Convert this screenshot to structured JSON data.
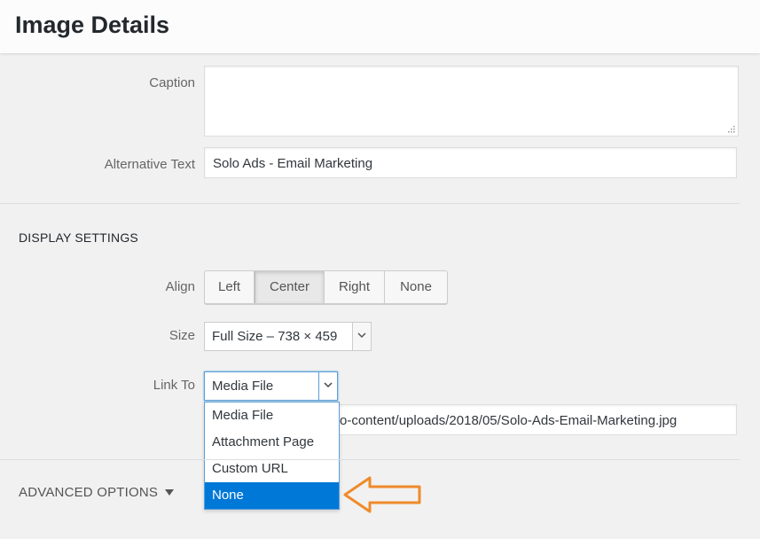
{
  "header": {
    "title": "Image Details"
  },
  "fields": {
    "caption_label": "Caption",
    "caption_value": "",
    "alt_label": "Alternative Text",
    "alt_value": "Solo Ads - Email Marketing",
    "url_value": "o-content/uploads/2018/05/Solo-Ads-Email-Marketing.jpg"
  },
  "display_settings": {
    "section_title": "DISPLAY SETTINGS",
    "align_label": "Align",
    "align_options": [
      "Left",
      "Center",
      "Right",
      "None"
    ],
    "align_selected": "Center",
    "size_label": "Size",
    "size_value": "Full Size – 738 × 459",
    "link_label": "Link To",
    "link_value": "Media File",
    "link_options": [
      "Media File",
      "Attachment Page",
      "Custom URL",
      "None"
    ],
    "link_highlighted": "None"
  },
  "advanced": {
    "label": "ADVANCED OPTIONS"
  },
  "colors": {
    "accent": "#0078d7",
    "focus_border": "#5b9dd9",
    "annotation_arrow": "#f08a2a"
  },
  "icons": {
    "dropdown": "chevron-down-icon",
    "expand": "triangle-down-icon",
    "annotation": "left-arrow-icon",
    "resize": "resize-grip-icon"
  }
}
